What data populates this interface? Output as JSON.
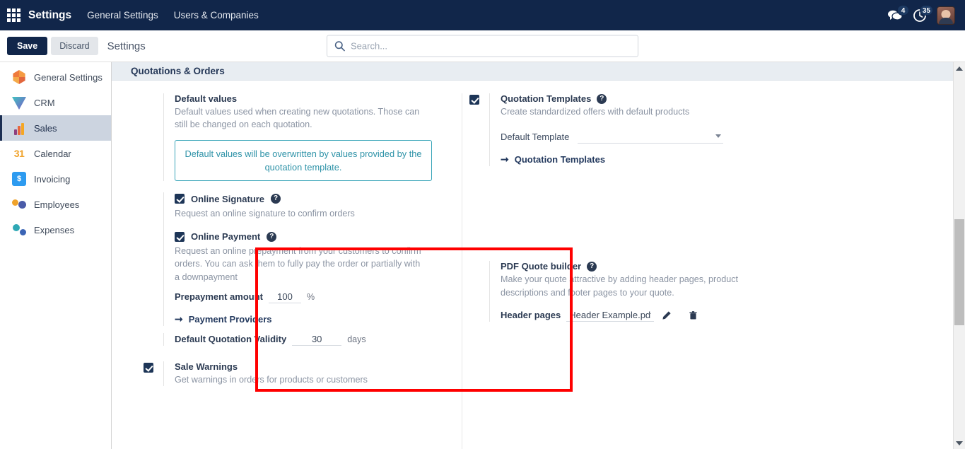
{
  "navbar": {
    "apps_icon": "apps-grid-icon",
    "brand": "Settings",
    "items": [
      {
        "label": "General Settings"
      },
      {
        "label": "Users & Companies"
      }
    ],
    "messages_icon": "chat-bubble-icon",
    "messages_count": "4",
    "activities_icon": "clock-icon",
    "activities_count": "35",
    "avatar_icon": "user-avatar"
  },
  "toolbar": {
    "save_label": "Save",
    "discard_label": "Discard",
    "breadcrumb": "Settings"
  },
  "search": {
    "icon": "search-icon",
    "placeholder": "Search...",
    "value": ""
  },
  "sidebar": {
    "items": [
      {
        "label": "General Settings",
        "icon": "gear-icon",
        "active": false
      },
      {
        "label": "CRM",
        "icon": "crm-icon",
        "active": false
      },
      {
        "label": "Sales",
        "icon": "sales-bar-chart-icon",
        "active": true
      },
      {
        "label": "Calendar",
        "icon": "calendar-31-icon",
        "active": false
      },
      {
        "label": "Invoicing",
        "icon": "invoice-icon",
        "active": false
      },
      {
        "label": "Employees",
        "icon": "employees-icon",
        "active": false
      },
      {
        "label": "Expenses",
        "icon": "expenses-icon",
        "active": false
      }
    ]
  },
  "section": {
    "title": "Quotations & Orders"
  },
  "settings": {
    "default_values": {
      "title": "Default values",
      "description": "Default values used when creating new quotations. Those can still be changed on each quotation.",
      "alert": "Default values will be overwritten by values provided by the quotation template."
    },
    "online_signature": {
      "label": "Online Signature",
      "checked": true,
      "help_icon": "help-circle-icon",
      "description": "Request an online signature to confirm orders"
    },
    "online_payment": {
      "label": "Online Payment",
      "checked": true,
      "help_icon": "help-circle-icon",
      "description": "Request an online prepayment from your customers to confirm orders. You can ask them to fully pay the order or partially with a downpayment",
      "prepayment_label": "Prepayment amount",
      "prepayment_value": "100",
      "prepayment_unit": "%",
      "link_label": "Payment Providers",
      "link_arrow": "arrow-right-icon"
    },
    "quotation_validity": {
      "label": "Default Quotation Validity",
      "value": "30",
      "unit": "days"
    },
    "sale_warnings": {
      "label": "Sale Warnings",
      "checked": true,
      "description": "Get warnings in orders for products or customers"
    },
    "quotation_templates": {
      "label": "Quotation Templates",
      "checked": true,
      "help_icon": "help-circle-icon",
      "description": "Create standardized offers with default products",
      "default_template_label": "Default Template",
      "default_template_value": "",
      "dropdown_icon": "chevron-down-icon",
      "link_label": "Quotation Templates",
      "link_arrow": "arrow-right-icon"
    },
    "pdf_quote_builder": {
      "label": "PDF Quote builder",
      "help_icon": "help-circle-icon",
      "description": "Make your quote attractive by adding header pages, product descriptions and footer pages to your quote.",
      "header_pages_label": "Header pages",
      "header_pages_value": "Header Example.pdf",
      "edit_icon": "pencil-icon",
      "delete_icon": "trash-icon"
    }
  },
  "annotation": {
    "highlight_color": "#ff0000"
  },
  "scrollbar": {
    "up_icon": "scroll-up-arrow-icon",
    "down_icon": "scroll-down-arrow-icon",
    "thumb": "scrollbar-thumb"
  }
}
